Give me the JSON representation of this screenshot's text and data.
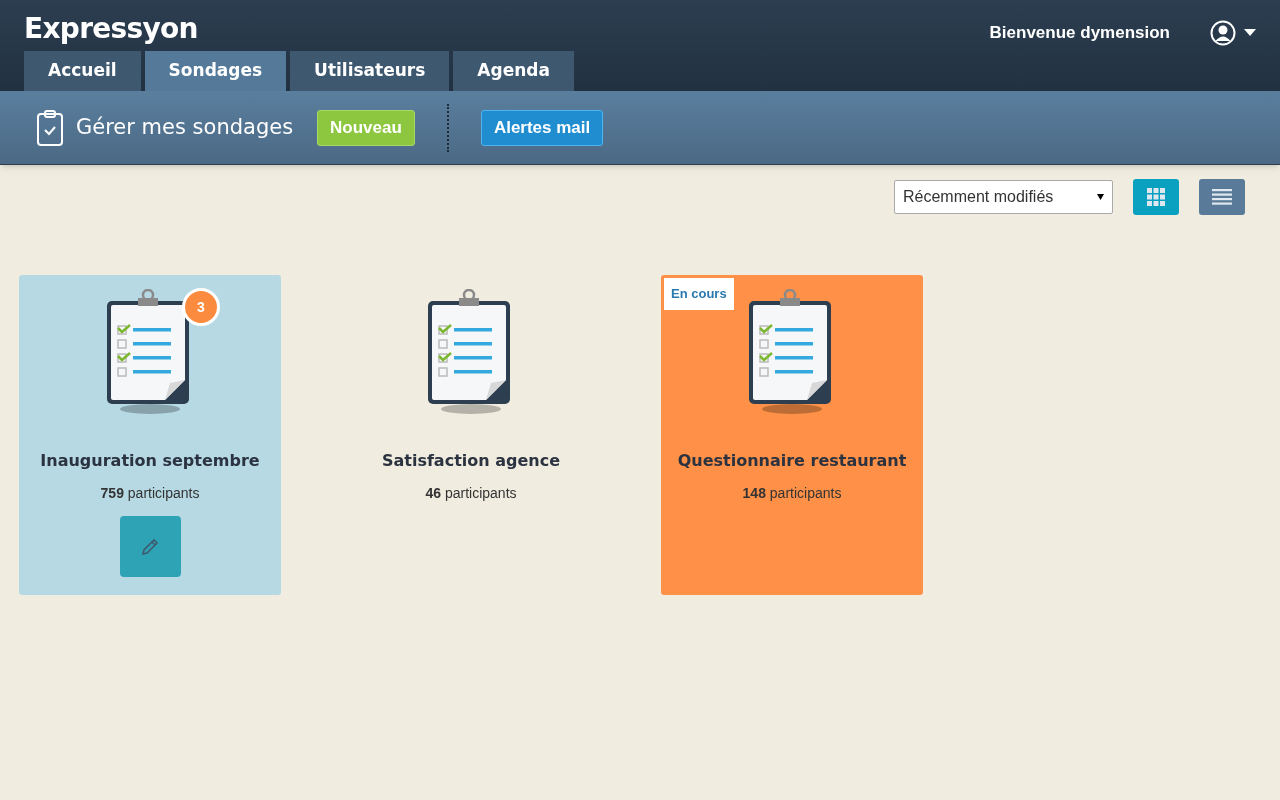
{
  "app": {
    "title": "Expressyon",
    "welcome": "Bienvenue dymension"
  },
  "tabs": [
    {
      "label": "Accueil",
      "selected": false
    },
    {
      "label": "Sondages",
      "selected": true
    },
    {
      "label": "Utilisateurs",
      "selected": false
    },
    {
      "label": "Agenda",
      "selected": false
    }
  ],
  "subbar": {
    "title": "Gérer mes sondages",
    "new_button": "Nouveau",
    "alerts_button": "Alertes mail"
  },
  "toolbar": {
    "sort_select": "Récemment modifiés",
    "views": [
      {
        "kind": "grid",
        "selected": true
      },
      {
        "kind": "list",
        "selected": false
      }
    ]
  },
  "cards": [
    {
      "title": "Inauguration septembre",
      "participants": "**759** participants",
      "badge": "3",
      "selected": true,
      "in_progress": false
    },
    {
      "title": "Satisfaction agence",
      "participants": "**46** participants",
      "selected": false,
      "in_progress": false
    },
    {
      "title": "Questionnaire restaurant",
      "participants": "**148** participants",
      "status": "En cours",
      "selected": false,
      "in_progress": true
    }
  ]
}
